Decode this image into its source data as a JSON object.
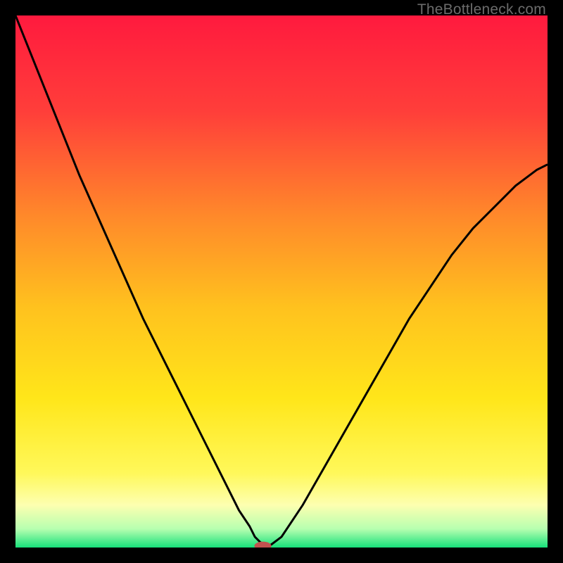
{
  "watermark": "TheBottleneck.com",
  "chart_data": {
    "type": "line",
    "title": "",
    "xlabel": "",
    "ylabel": "",
    "xlim": [
      0,
      100
    ],
    "ylim": [
      0,
      100
    ],
    "grid": false,
    "legend": false,
    "background_gradient": {
      "stops": [
        {
          "offset": 0.0,
          "color": "#ff1a3e"
        },
        {
          "offset": 0.18,
          "color": "#ff3e3a"
        },
        {
          "offset": 0.38,
          "color": "#ff8a2a"
        },
        {
          "offset": 0.55,
          "color": "#ffc21e"
        },
        {
          "offset": 0.72,
          "color": "#ffe61a"
        },
        {
          "offset": 0.86,
          "color": "#fff85a"
        },
        {
          "offset": 0.92,
          "color": "#fdffb0"
        },
        {
          "offset": 0.965,
          "color": "#b7ffb0"
        },
        {
          "offset": 1.0,
          "color": "#17e07a"
        }
      ]
    },
    "series": [
      {
        "name": "bottleneck-curve",
        "color": "#000000",
        "stroke_width": 3,
        "x": [
          0,
          4,
          8,
          12,
          16,
          20,
          24,
          28,
          32,
          36,
          40,
          42,
          44,
          45,
          46,
          47,
          48,
          50,
          54,
          58,
          62,
          66,
          70,
          74,
          78,
          82,
          86,
          90,
          94,
          98,
          100
        ],
        "y": [
          100,
          90,
          80,
          70,
          61,
          52,
          43,
          35,
          27,
          19,
          11,
          7,
          4,
          2,
          1,
          0.5,
          0.5,
          2,
          8,
          15,
          22,
          29,
          36,
          43,
          49,
          55,
          60,
          64,
          68,
          71,
          72
        ]
      }
    ],
    "marker": {
      "name": "bottleneck-point",
      "x": 46.5,
      "y": 0.3,
      "rx": 1.6,
      "ry": 0.8,
      "color": "#c1524f"
    }
  }
}
